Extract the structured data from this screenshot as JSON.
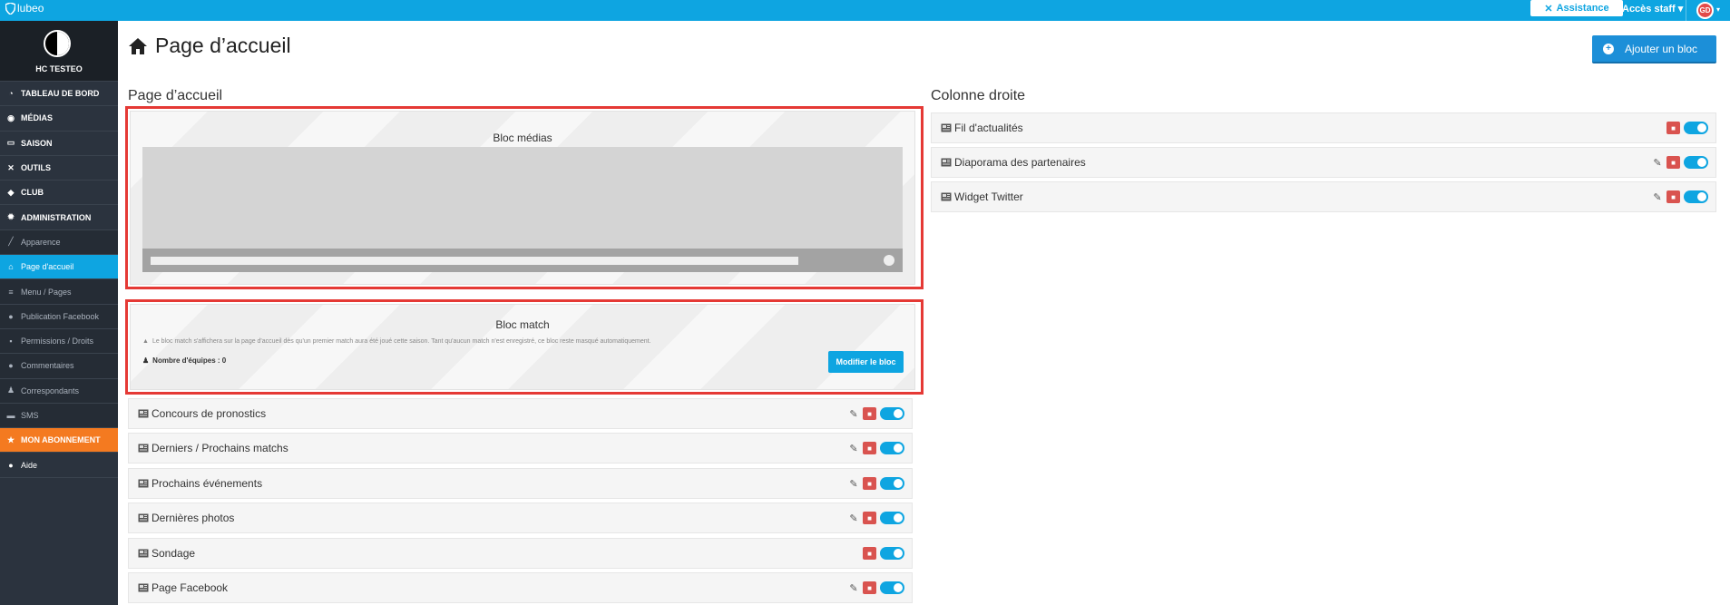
{
  "topbar": {
    "brand": "lubeo",
    "assistance_label": "Assistance",
    "staff_label": "Accès staff",
    "avatar_initials": "GD",
    "accent": "#0ea5e1"
  },
  "sidebar": {
    "club_name": "HC TESTEO",
    "items": [
      {
        "label": "TABLEAU DE BORD",
        "icon": "dashboard-icon"
      },
      {
        "label": "MÉDIAS",
        "icon": "camera-icon"
      },
      {
        "label": "SAISON",
        "icon": "calendar-icon"
      },
      {
        "label": "OUTILS",
        "icon": "tools-icon"
      },
      {
        "label": "CLUB",
        "icon": "shield-icon"
      },
      {
        "label": "ADMINISTRATION",
        "icon": "gear-icon"
      },
      {
        "label": "Apparence",
        "icon": "brush-icon"
      },
      {
        "label": "Page d'accueil",
        "icon": "home-icon"
      },
      {
        "label": "Menu / Pages",
        "icon": "menu-icon"
      },
      {
        "label": "Publication Facebook",
        "icon": "facebook-icon"
      },
      {
        "label": "Permissions / Droits",
        "icon": "lock-icon"
      },
      {
        "label": "Commentaires",
        "icon": "comment-icon"
      },
      {
        "label": "Correspondants",
        "icon": "user-icon"
      },
      {
        "label": "SMS",
        "icon": "sms-icon"
      },
      {
        "label": "MON ABONNEMENT",
        "icon": "star-icon"
      },
      {
        "label": "Aide",
        "icon": "help-icon"
      }
    ]
  },
  "main": {
    "title": "Page d’accueil",
    "add_bloc_label": "Ajouter un bloc",
    "left_section_title": "Page d’accueil",
    "right_section_title": "Colonne droite",
    "media_bloc_label": "Bloc médias",
    "match_bloc_label": "Bloc match",
    "match_warning": "Le bloc match s'affichera sur la page d'accueil dès qu'un premier match aura été joué cette saison. Tant qu'aucun match n'est enregistré, ce bloc reste masqué automatiquement.",
    "match_count": "Nombre d'équipes : 0",
    "modify_label": "Modifier le bloc",
    "left_rows": [
      {
        "label": "Concours de pronostics",
        "edit": true
      },
      {
        "label": "Derniers / Prochains matchs",
        "edit": true
      },
      {
        "label": "Prochains événements",
        "edit": true
      },
      {
        "label": "Dernières photos",
        "edit": true
      },
      {
        "label": "Sondage",
        "edit": false
      },
      {
        "label": "Page Facebook",
        "edit": true
      }
    ],
    "right_rows": [
      {
        "label": "Fil d'actualités",
        "edit": false
      },
      {
        "label": "Diaporama des partenaires",
        "edit": true
      },
      {
        "label": "Widget Twitter",
        "edit": true
      }
    ]
  }
}
